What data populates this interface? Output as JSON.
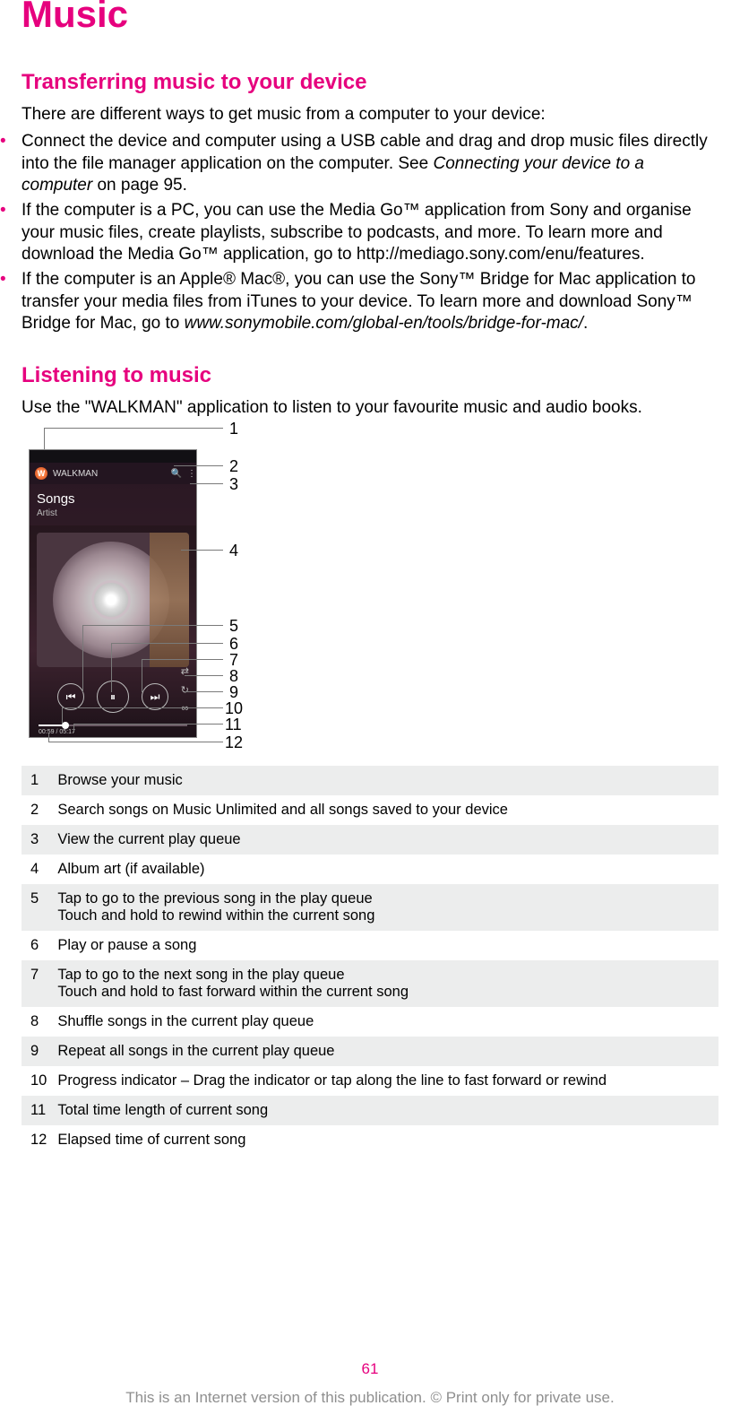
{
  "title": "Music",
  "section1": {
    "heading": "Transferring music to your device",
    "intro": "There are different ways to get music from a computer to your device:",
    "bullets": [
      {
        "pre": "Connect the device and computer using a USB cable and drag and drop music files directly into the file manager application on the computer. See ",
        "em": "Connecting your device to a computer",
        "post": " on page 95."
      },
      {
        "pre": "If the computer is a PC, you can use the Media Go™ application from Sony and organise your music files, create playlists, subscribe to podcasts, and more. To learn more and download the Media Go™ application, go to http://mediago.sony.com/enu/features.",
        "em": "",
        "post": ""
      },
      {
        "pre": "If the computer is an Apple® Mac®, you can use the Sony™ Bridge for Mac application to transfer your media files from iTunes to your device. To learn more and download Sony™ Bridge for Mac, go to ",
        "em": "www.sonymobile.com/global-en/tools/bridge-for-mac/",
        "post": "."
      }
    ]
  },
  "section2": {
    "heading": "Listening to music",
    "intro": "Use the \"WALKMAN\" application to listen to your favourite music and audio books."
  },
  "figure": {
    "app_name": "WALKMAN",
    "songs_label": "Songs",
    "artist_label": "Artist",
    "elapsed": "00:59 / 05:17",
    "callouts": [
      "1",
      "2",
      "3",
      "4",
      "5",
      "6",
      "7",
      "8",
      "9",
      "10",
      "11",
      "12"
    ]
  },
  "legend": [
    {
      "n": "1",
      "t": "Browse your music"
    },
    {
      "n": "2",
      "t": "Search songs on Music Unlimited and all songs saved to your device"
    },
    {
      "n": "3",
      "t": "View the current play queue"
    },
    {
      "n": "4",
      "t": "Album art (if available)"
    },
    {
      "n": "5",
      "t": "Tap to go to the previous song in the play queue\nTouch and hold to rewind within the current song"
    },
    {
      "n": "6",
      "t": "Play or pause a song"
    },
    {
      "n": "7",
      "t": "Tap to go to the next song in the play queue\nTouch and hold to fast forward within the current song"
    },
    {
      "n": "8",
      "t": "Shuffle songs in the current play queue"
    },
    {
      "n": "9",
      "t": "Repeat all songs in the current play queue"
    },
    {
      "n": "10",
      "t": "Progress indicator – Drag the indicator or tap along the line to fast forward or rewind"
    },
    {
      "n": "11",
      "t": "Total time length of current song"
    },
    {
      "n": "12",
      "t": "Elapsed time of current song"
    }
  ],
  "page_number": "61",
  "footer": "This is an Internet version of this publication. © Print only for private use."
}
